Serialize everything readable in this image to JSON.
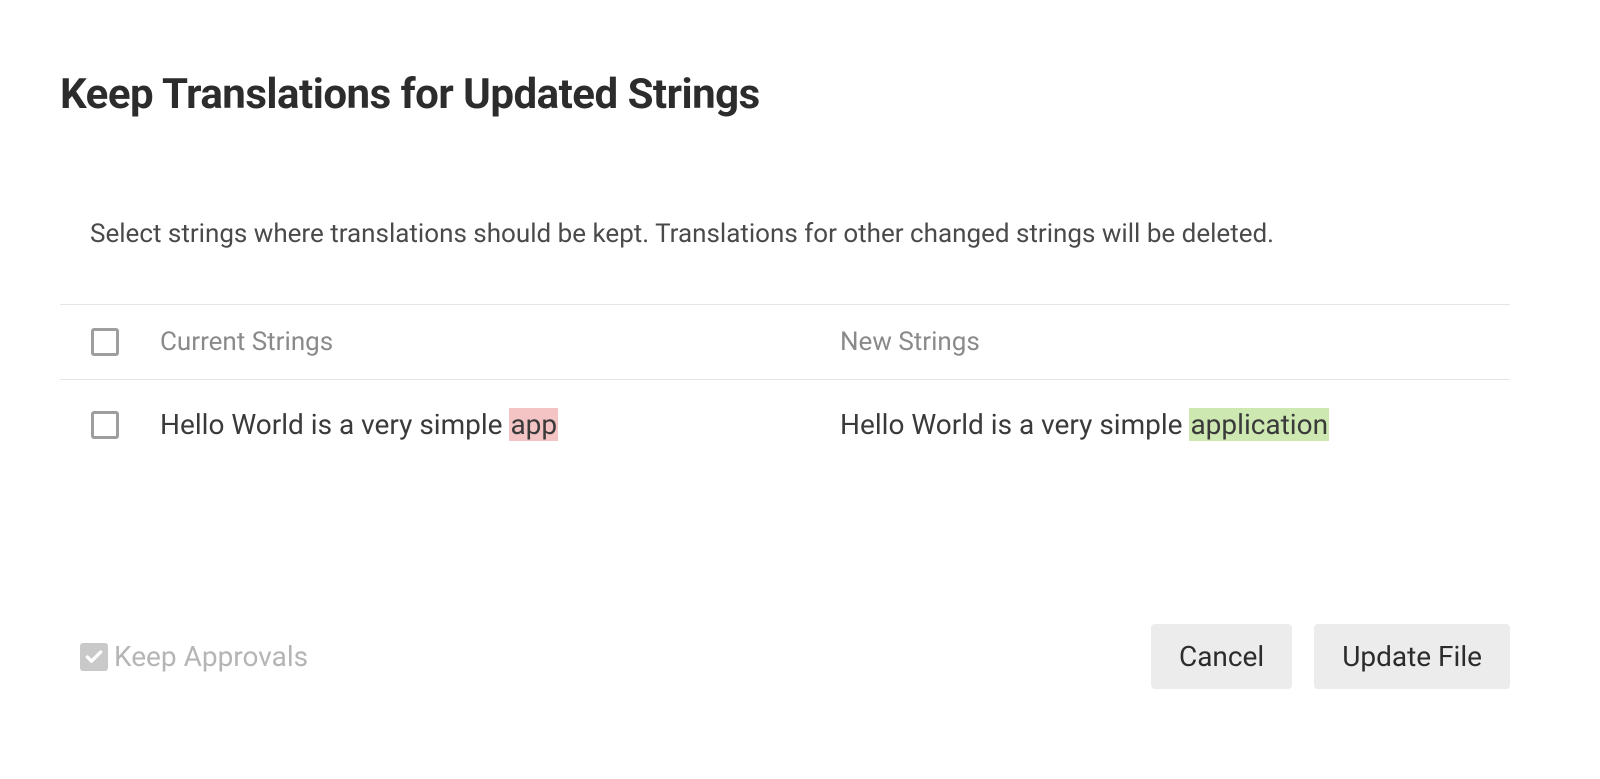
{
  "title": "Keep Translations for Updated Strings",
  "description": "Select strings where translations should be kept. Translations for other changed strings will be deleted.",
  "table": {
    "headers": {
      "current": "Current Strings",
      "new": "New Strings"
    },
    "rows": [
      {
        "current_prefix": "Hello World is a very simple ",
        "current_diff": "app",
        "new_prefix": "Hello World is a very simple ",
        "new_diff": "application"
      }
    ]
  },
  "footer": {
    "keep_approvals_label": "Keep Approvals",
    "cancel_label": "Cancel",
    "update_label": "Update File"
  },
  "colors": {
    "diff_del_bg": "#f4c4c4",
    "diff_add_bg": "#cde8b1",
    "button_bg": "#ececec"
  }
}
